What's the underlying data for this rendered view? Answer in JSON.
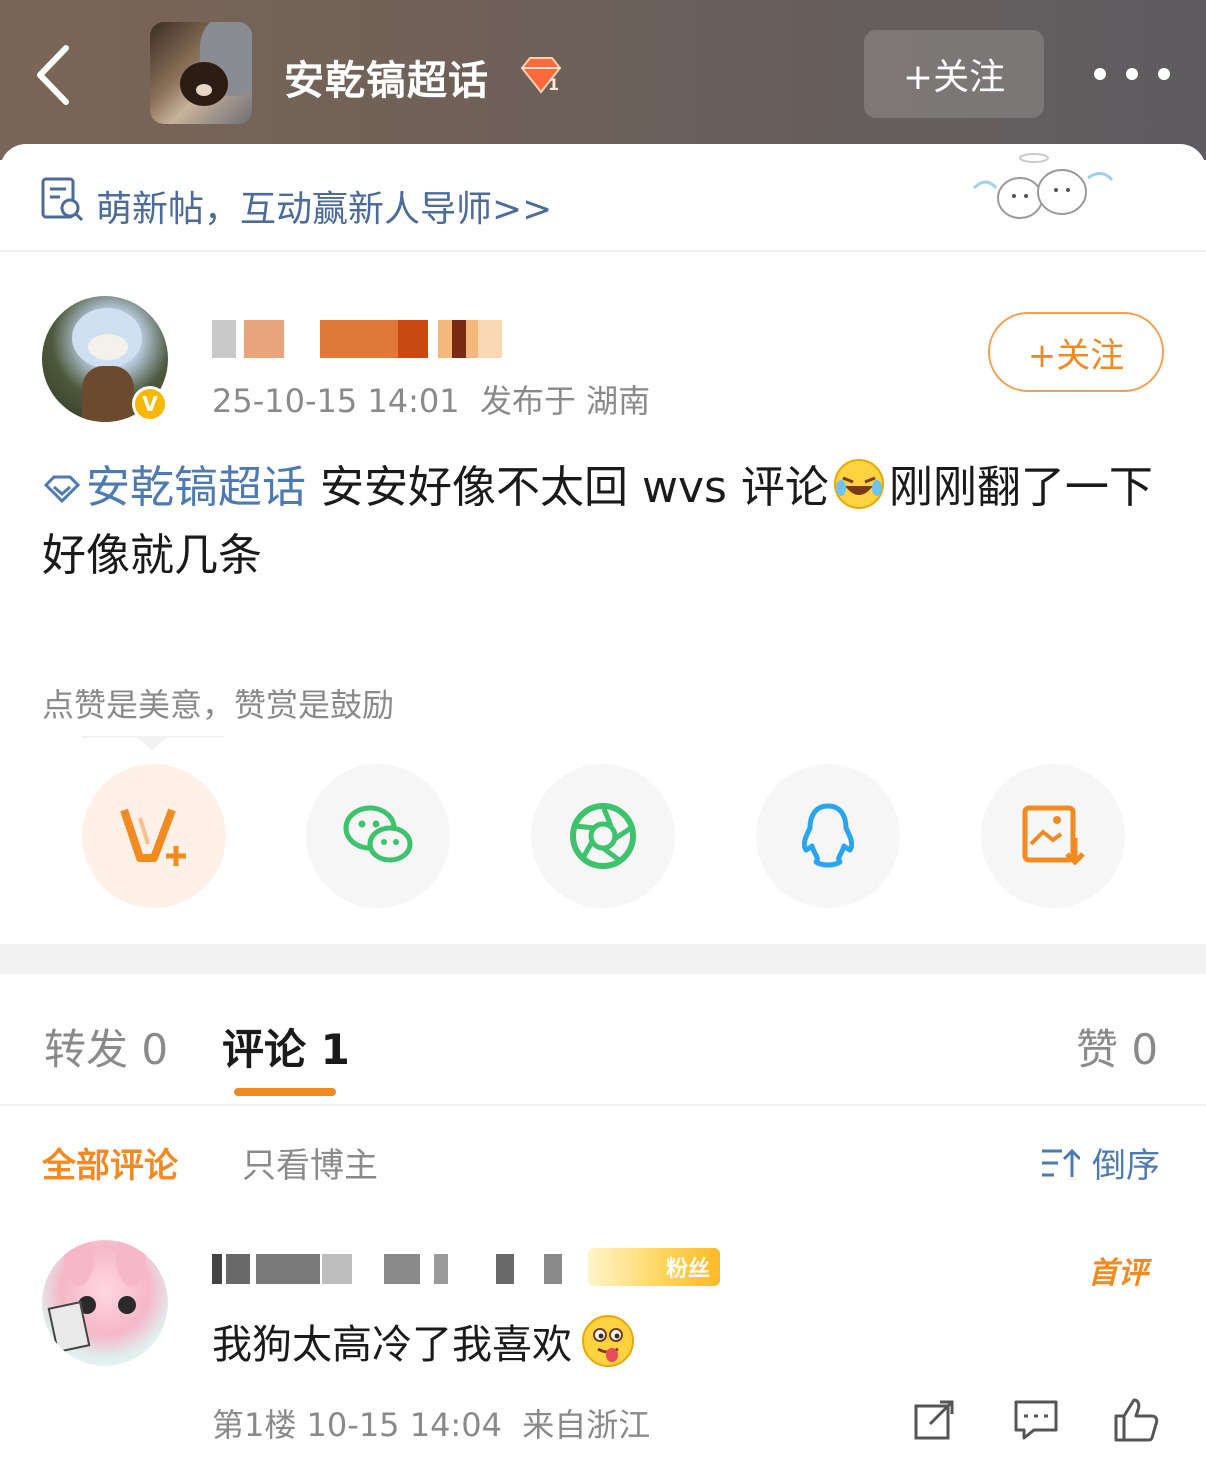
{
  "header": {
    "topic_title": "安乾镐超话",
    "follow_label": "+关注"
  },
  "banner": {
    "text": "萌新帖，互动赢新人导师>>"
  },
  "post": {
    "timestamp": "25-10-15 14:01",
    "location": "发布于 湖南",
    "follow_label": "+关注",
    "topic_link": "安乾镐超话",
    "text_part1": " 安安好像不太回 wvs 评论",
    "text_part2": "刚刚翻了一下好像就几条",
    "tip": "点赞是美意，赞赏是鼓励"
  },
  "share_buttons": [
    {
      "name": "reward",
      "icon": "v-plus-icon"
    },
    {
      "name": "wechat",
      "icon": "wechat-icon"
    },
    {
      "name": "moments",
      "icon": "moments-icon"
    },
    {
      "name": "qq",
      "icon": "qq-icon"
    },
    {
      "name": "save-image",
      "icon": "save-image-icon"
    }
  ],
  "tabs": {
    "repost": "转发 0",
    "comments": "评论 1",
    "likes": "赞 0"
  },
  "filters": {
    "all": "全部评论",
    "poster_only": "只看博主",
    "sort": "倒序"
  },
  "comment": {
    "fan_badge": "粉丝",
    "first_badge": "首评",
    "text": "我狗太高冷了我喜欢",
    "floor": "第1楼",
    "timestamp": "10-15 14:04",
    "location": "来自浙江"
  },
  "colors": {
    "accent": "#f28a22",
    "link": "#4e7ab4",
    "muted": "#8a8a8a"
  }
}
